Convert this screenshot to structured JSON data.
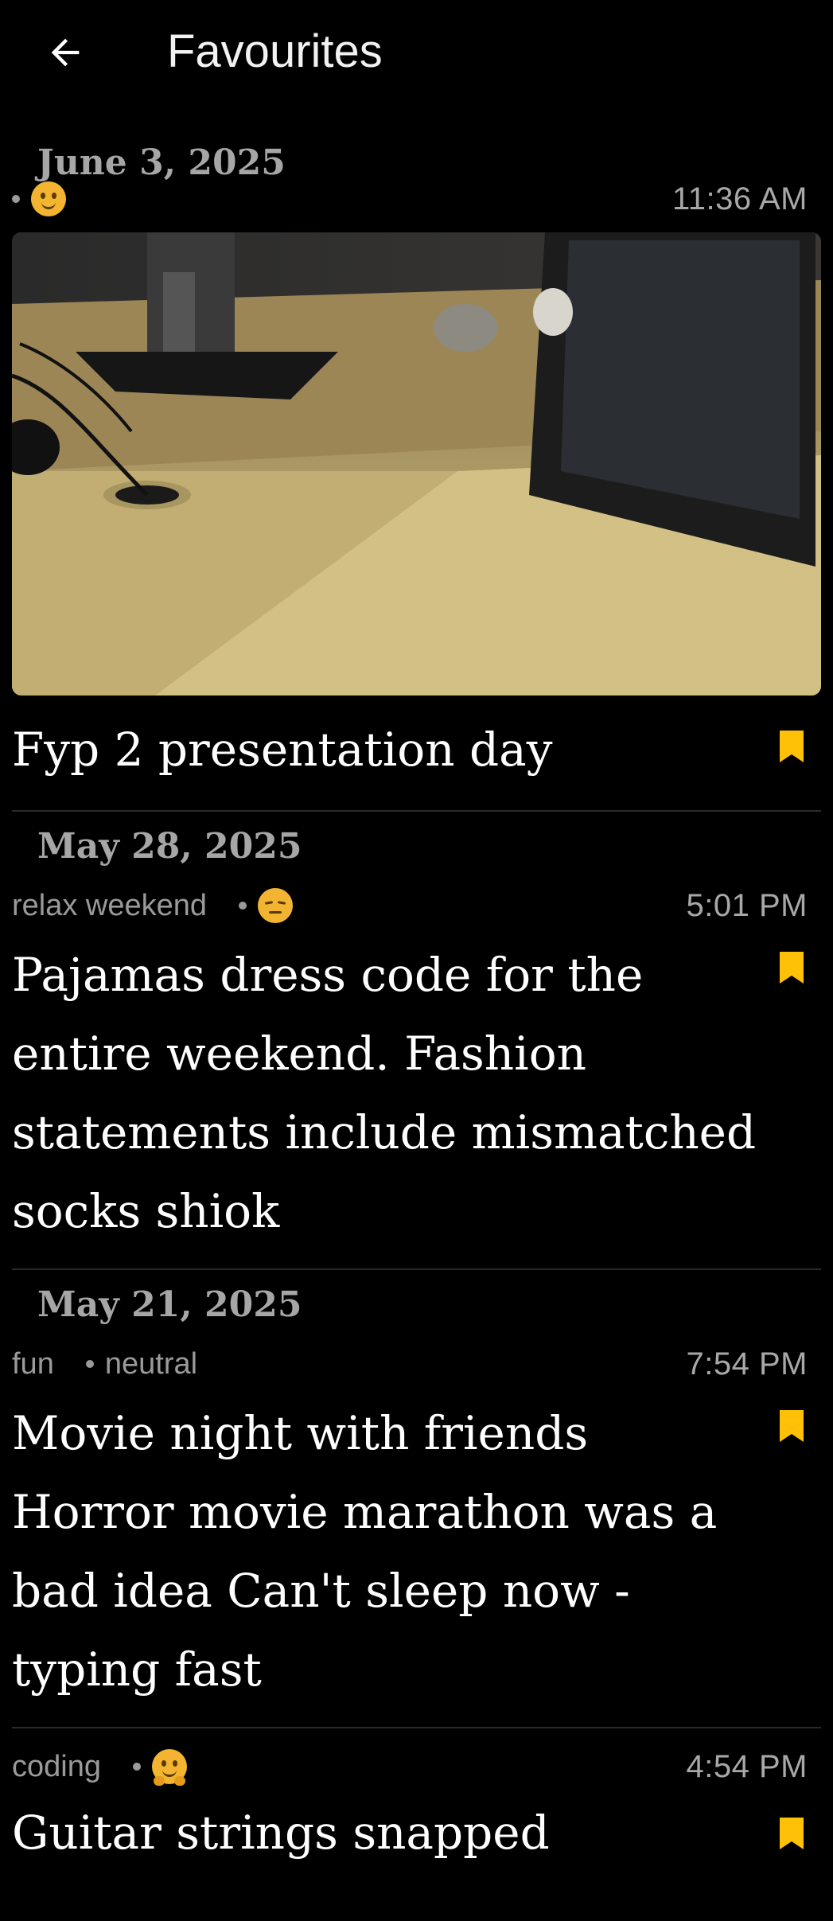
{
  "header": {
    "title": "Favourites"
  },
  "colors": {
    "background": "#000000",
    "bookmark": "#FFC107",
    "emoji": "#F2B431"
  },
  "entries": [
    {
      "date": "June 3, 2025",
      "tag": "",
      "mood_icon": "slightly-smiling-face-icon",
      "time": "11:36 AM",
      "has_photo": true,
      "text": "Fyp 2 presentation day"
    },
    {
      "date": "May 28, 2025",
      "tag": "relax weekend",
      "mood_icon": "relieved-face-icon",
      "time": "5:01 PM",
      "text": "Pajamas dress code for the entire weekend. Fashion statements include mismatched socks shiok"
    },
    {
      "date": "May 21, 2025",
      "tag": "fun",
      "mood": "neutral",
      "time": "7:54 PM",
      "text": "Movie night with friends Horror movie marathon was a bad idea Can't sleep now - typing fast"
    },
    {
      "tag": "coding",
      "mood_icon": "hugging-face-icon",
      "time": "4:54 PM",
      "text": "Guitar strings snapped"
    }
  ]
}
